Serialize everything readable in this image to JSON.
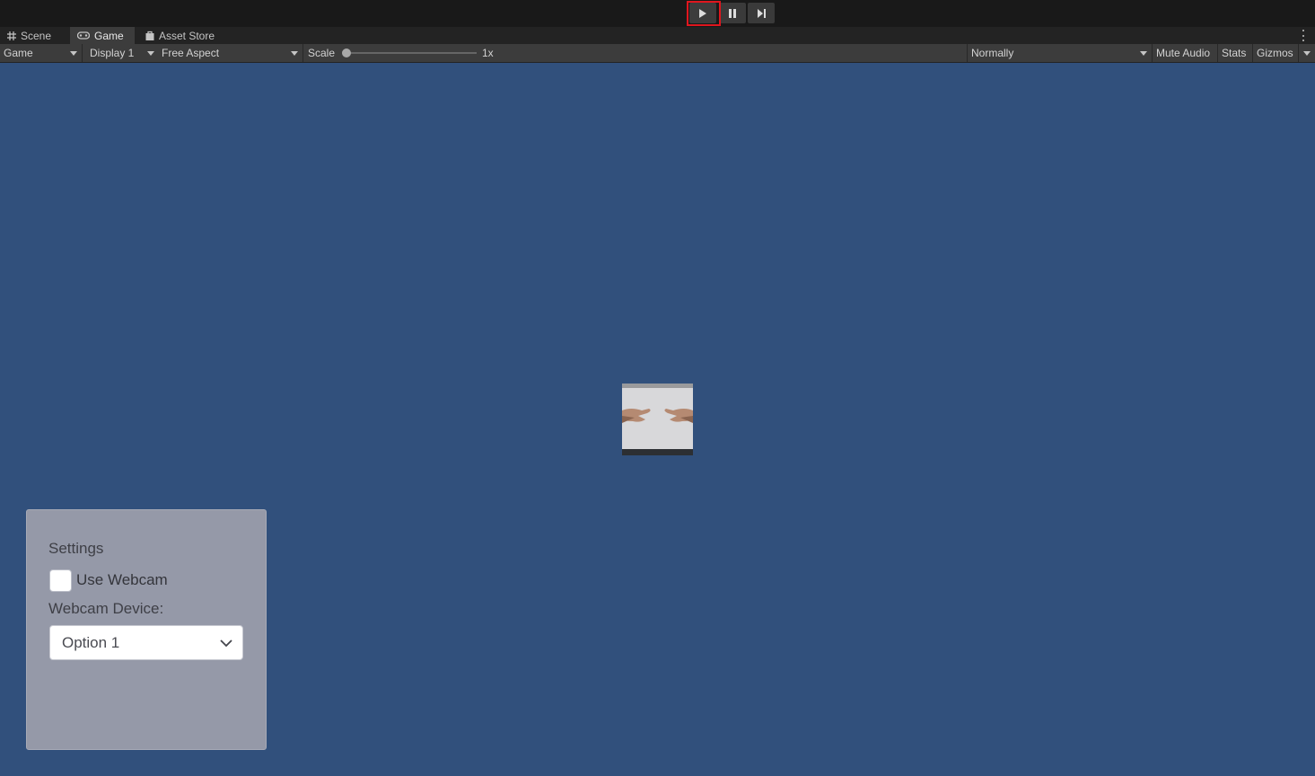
{
  "playbar": {
    "play_icon": "play-icon",
    "pause_icon": "pause-icon",
    "step_icon": "step-icon",
    "highlight_color": "#e0161e"
  },
  "tabs": [
    {
      "label": "Scene",
      "icon": "grid-icon"
    },
    {
      "label": "Game",
      "icon": "gamepad-icon"
    },
    {
      "label": "Asset Store",
      "icon": "shopping-bag-icon"
    }
  ],
  "toolbar": {
    "view_mode": "Game",
    "display": "Display 1",
    "aspect": "Free Aspect",
    "scale_label": "Scale",
    "scale_value": "1x",
    "play_mode": "Normally",
    "mute_audio": "Mute Audio",
    "stats": "Stats",
    "gizmos": "Gizmos"
  },
  "game": {
    "background_color": "#31507c",
    "settings_panel": {
      "title": "Settings",
      "use_webcam_label": "Use Webcam",
      "use_webcam_checked": false,
      "device_label": "Webcam Device:",
      "device_selected": "Option 1"
    }
  }
}
